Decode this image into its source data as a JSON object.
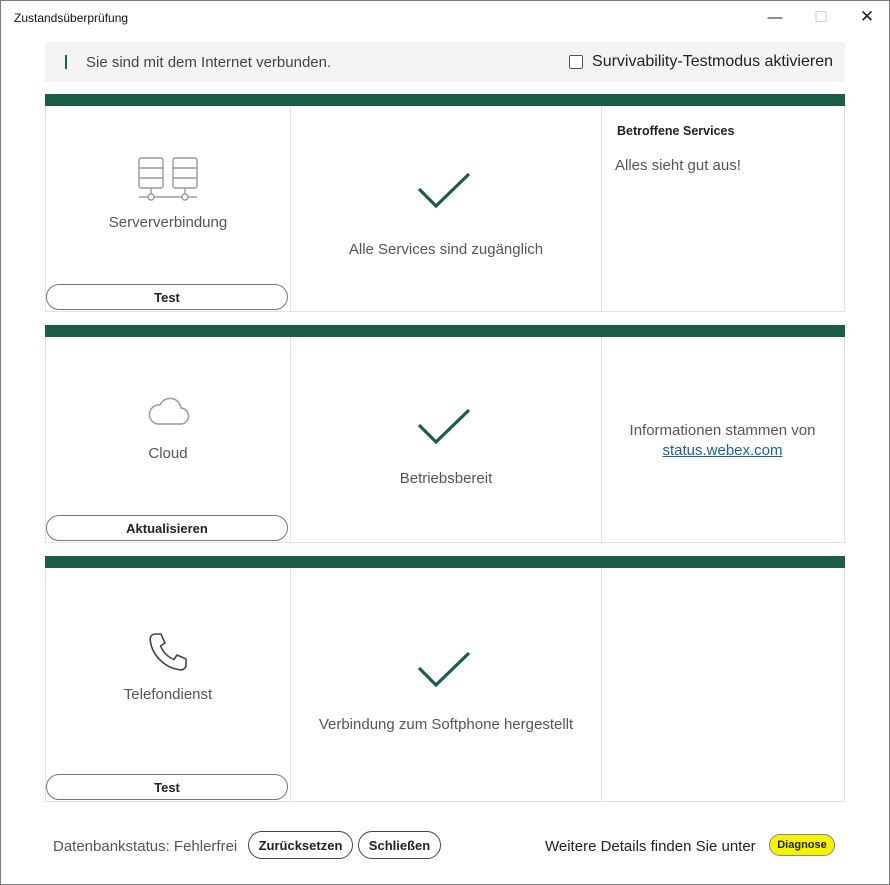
{
  "window": {
    "title": "Zustandsüberprüfung",
    "minimize_glyph": "—",
    "maximize_glyph": "☐",
    "close_glyph": "✕"
  },
  "status": {
    "text": "Sie sind mit dem Internet verbunden.",
    "survivability_label": "Survivability-Testmodus aktivieren",
    "survivability_checked": false
  },
  "cards": [
    {
      "icon": "server-icon",
      "label": "Serververbindung",
      "button": "Test",
      "status_icon": "checkmark-icon",
      "status_text": "Alle Services sind zugänglich",
      "side_title": "Betroffene Services",
      "side_text": "Alles sieht gut aus!"
    },
    {
      "icon": "cloud-icon",
      "label": "Cloud",
      "button": "Aktualisieren",
      "status_icon": "checkmark-icon",
      "status_text": "Betriebsbereit",
      "side_text": "Informationen stammen von",
      "side_link": "status.webex.com"
    },
    {
      "icon": "phone-icon",
      "label": "Telefondienst",
      "button": "Test",
      "status_icon": "checkmark-icon",
      "status_text": "Verbindung zum Softphone hergestellt"
    }
  ],
  "footer": {
    "db_status": "Datenbankstatus: Fehlerfrei",
    "reset_button": "Zurücksetzen",
    "close_button": "Schließen",
    "details_text": "Weitere Details finden Sie unter",
    "diagnose_button": "Diagnose"
  },
  "colors": {
    "band": "#1b5e45",
    "check": "#1b5e45",
    "link": "#1a5fa8",
    "diagnose_highlight": "#f5f200"
  }
}
